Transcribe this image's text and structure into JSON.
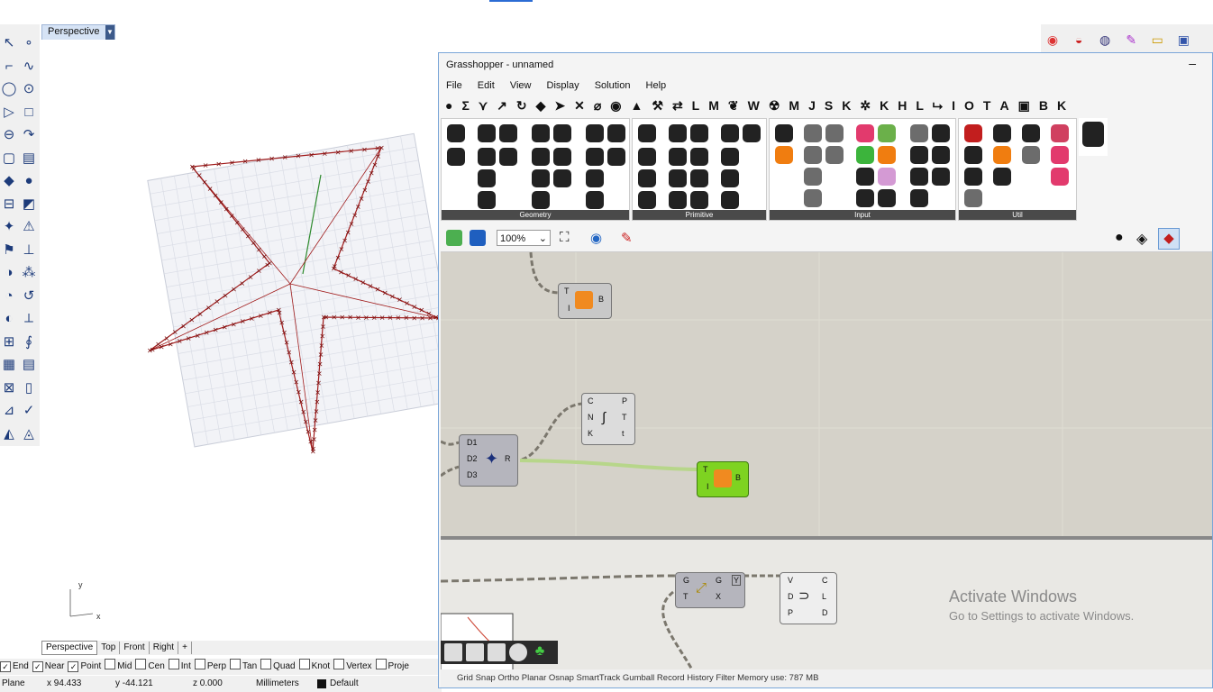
{
  "rhino": {
    "viewport_label": "Perspective",
    "left_tools": [
      "↖",
      "∘",
      "⌐",
      "∿",
      "◯",
      "⊙",
      "▷",
      "□",
      "⊖",
      "↷",
      "▢",
      "▤",
      "◆",
      "●",
      "⊟",
      "◩",
      "✦",
      "⚠",
      "⚑",
      "⊥",
      "◑",
      "⁂",
      "◔",
      "↺",
      "◐",
      "⟂",
      "⊞",
      "∮",
      "▦",
      "▤",
      "⊠",
      "▯",
      "⊿",
      "✓",
      "◭",
      "◬"
    ],
    "right_icons": [
      "◉",
      "◒",
      "◍",
      "✎",
      "▭",
      "▣"
    ],
    "view_tabs": [
      "Perspective",
      "Top",
      "Front",
      "Right",
      "+"
    ],
    "osnap": [
      {
        "label": "End",
        "checked": true
      },
      {
        "label": "Near",
        "checked": true
      },
      {
        "label": "Point",
        "checked": true
      },
      {
        "label": "Mid",
        "checked": false
      },
      {
        "label": "Cen",
        "checked": false
      },
      {
        "label": "Int",
        "checked": false
      },
      {
        "label": "Perp",
        "checked": false
      },
      {
        "label": "Tan",
        "checked": false
      },
      {
        "label": "Quad",
        "checked": false
      },
      {
        "label": "Knot",
        "checked": false
      },
      {
        "label": "Vertex",
        "checked": false
      },
      {
        "label": "Proje",
        "checked": false
      }
    ],
    "status": {
      "cplane": "Plane",
      "x": "x 94.433",
      "y": "y -44.121",
      "z": "z 0.000",
      "units": "Millimeters",
      "layer": "Default"
    }
  },
  "grasshopper": {
    "title": "Grasshopper - unnamed",
    "minimize": "–",
    "menu": [
      "File",
      "Edit",
      "View",
      "Display",
      "Solution",
      "Help"
    ],
    "component_tabs": [
      "●",
      "Σ",
      "⋎",
      "↗",
      "↻",
      "◆",
      "➤",
      "✕",
      "⌀",
      "◉",
      "▲",
      "⚒",
      "⇄",
      "L",
      "M",
      "❦",
      "W",
      "☢",
      "M",
      "J",
      "S",
      "K",
      "✲",
      "K",
      "H",
      "L",
      "⮡",
      "I",
      "O",
      "T",
      "A",
      "▣",
      "B",
      "K"
    ],
    "panels": [
      "Geometry",
      "Primitive",
      "Input",
      "Util"
    ],
    "zoom": "100%",
    "components": {
      "toggle1": {
        "in": [
          "T",
          "I"
        ],
        "out": "B"
      },
      "curve": {
        "in": [
          "C",
          "N",
          "K"
        ],
        "out": [
          "P",
          "T",
          "t"
        ]
      },
      "pt": {
        "in": [
          "D1",
          "D2",
          "D3"
        ],
        "out": "R"
      },
      "toggle2": {
        "in": [
          "T",
          "I"
        ],
        "out": "B"
      },
      "geo": {
        "in": [
          "G",
          "T"
        ],
        "out": [
          "G",
          "X"
        ],
        "flag": "Y"
      },
      "arc": {
        "in": [
          "V",
          "D",
          "P"
        ],
        "out": [
          "C",
          "L",
          "D"
        ]
      }
    },
    "status": "Grid Snap   Ortho   Planar   Osnap   SmartTrack   Gumball   Record History   Filter   Memory use: 787 MB"
  },
  "watermark": {
    "line1": "Activate Windows",
    "line2": "Go to Settings to activate Windows."
  }
}
